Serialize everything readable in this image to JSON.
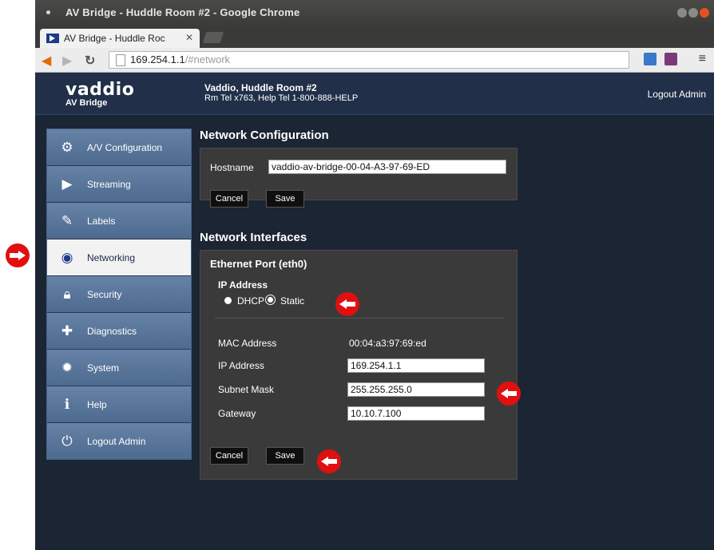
{
  "browser": {
    "window_title": "AV Bridge - Huddle Room #2 - Google Chrome",
    "tab_title": "AV Bridge - Huddle Roc",
    "url_host": "169.254.1.1",
    "url_path": "/#network"
  },
  "header": {
    "logo_text": "vaddio",
    "logo_sub": "AV Bridge",
    "site_title": "Vaddio, Huddle Room #2",
    "site_sub": "Rm Tel x763, Help Tel 1-800-888-HELP",
    "logout": "Logout Admin"
  },
  "sidebar": {
    "items": [
      {
        "label": "A/V Configuration",
        "icon": "av-config-icon"
      },
      {
        "label": "Streaming",
        "icon": "streaming-icon"
      },
      {
        "label": "Labels",
        "icon": "labels-icon"
      },
      {
        "label": "Networking",
        "icon": "networking-icon",
        "active": true
      },
      {
        "label": "Security",
        "icon": "security-icon"
      },
      {
        "label": "Diagnostics",
        "icon": "diagnostics-icon"
      },
      {
        "label": "System",
        "icon": "system-icon"
      },
      {
        "label": "Help",
        "icon": "help-icon"
      },
      {
        "label": "Logout Admin",
        "icon": "power-icon"
      }
    ]
  },
  "network_config": {
    "heading": "Network Configuration",
    "hostname_label": "Hostname",
    "hostname_value": "vaddio-av-bridge-00-04-A3-97-69-ED",
    "cancel": "Cancel",
    "save": "Save"
  },
  "network_interfaces": {
    "heading": "Network Interfaces",
    "port_title": "Ethernet Port (eth0)",
    "ip_address_heading": "IP Address",
    "dhcp_label": "DHCP",
    "static_label": "Static",
    "selected_mode": "Static",
    "mac_label": "MAC Address",
    "mac_value": "00:04:a3:97:69:ed",
    "ip_label": "IP Address",
    "ip_value": "169.254.1.1",
    "subnet_label": "Subnet Mask",
    "subnet_value": "255.255.255.0",
    "gateway_label": "Gateway",
    "gateway_value": "10.10.7.100",
    "cancel": "Cancel",
    "save": "Save"
  },
  "colors": {
    "accent_marker": "#e01010",
    "page_bg": "#1b2533",
    "panel_bg": "#3a3a3a"
  }
}
